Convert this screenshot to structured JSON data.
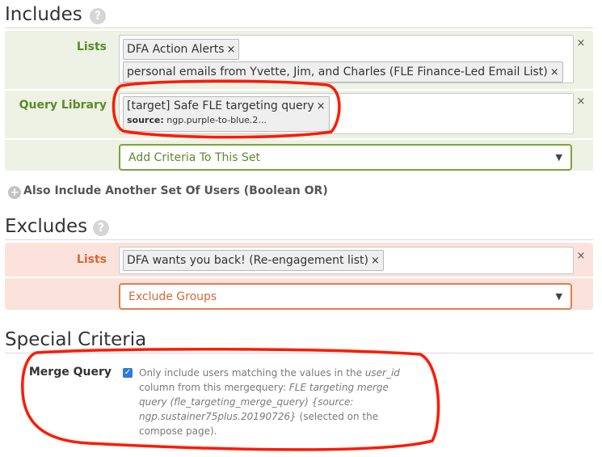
{
  "includes": {
    "title": "Includes",
    "help_icon": "?",
    "lists_label": "Lists",
    "lists_tokens": [
      "DFA Action Alerts",
      "personal emails from Yvette, Jim, and Charles (FLE Finance-Led Email List)"
    ],
    "query_library_label": "Query Library",
    "query_token": {
      "title": "[target] Safe FLE targeting query",
      "source_label": "source:",
      "source_value": "ngp.purple-to-blue.2..."
    },
    "add_criteria": "Add Criteria To This Set",
    "remove_glyph": "×"
  },
  "also_include": {
    "plus": "+",
    "label": "Also Include Another Set Of Users (Boolean OR)"
  },
  "excludes": {
    "title": "Excludes",
    "help_icon": "?",
    "lists_label": "Lists",
    "lists_tokens": [
      "DFA wants you back! (Re-engagement list)"
    ],
    "exclude_groups": "Exclude Groups",
    "remove_glyph": "×"
  },
  "special": {
    "title": "Special Criteria",
    "merge_label": "Merge Query",
    "checked": true,
    "checkmark": "✓",
    "desc_1": "Only include users matching the values in the",
    "desc_col": "user_id",
    "desc_2": "column from this mergequery:",
    "desc_q": "FLE targeting merge query (fle_targeting_merge_query) {source: ngp.sustainer75plus.20190726}",
    "desc_3": "(selected on the compose page)."
  },
  "caret": "▼",
  "annotation_color": "#ff1a00"
}
